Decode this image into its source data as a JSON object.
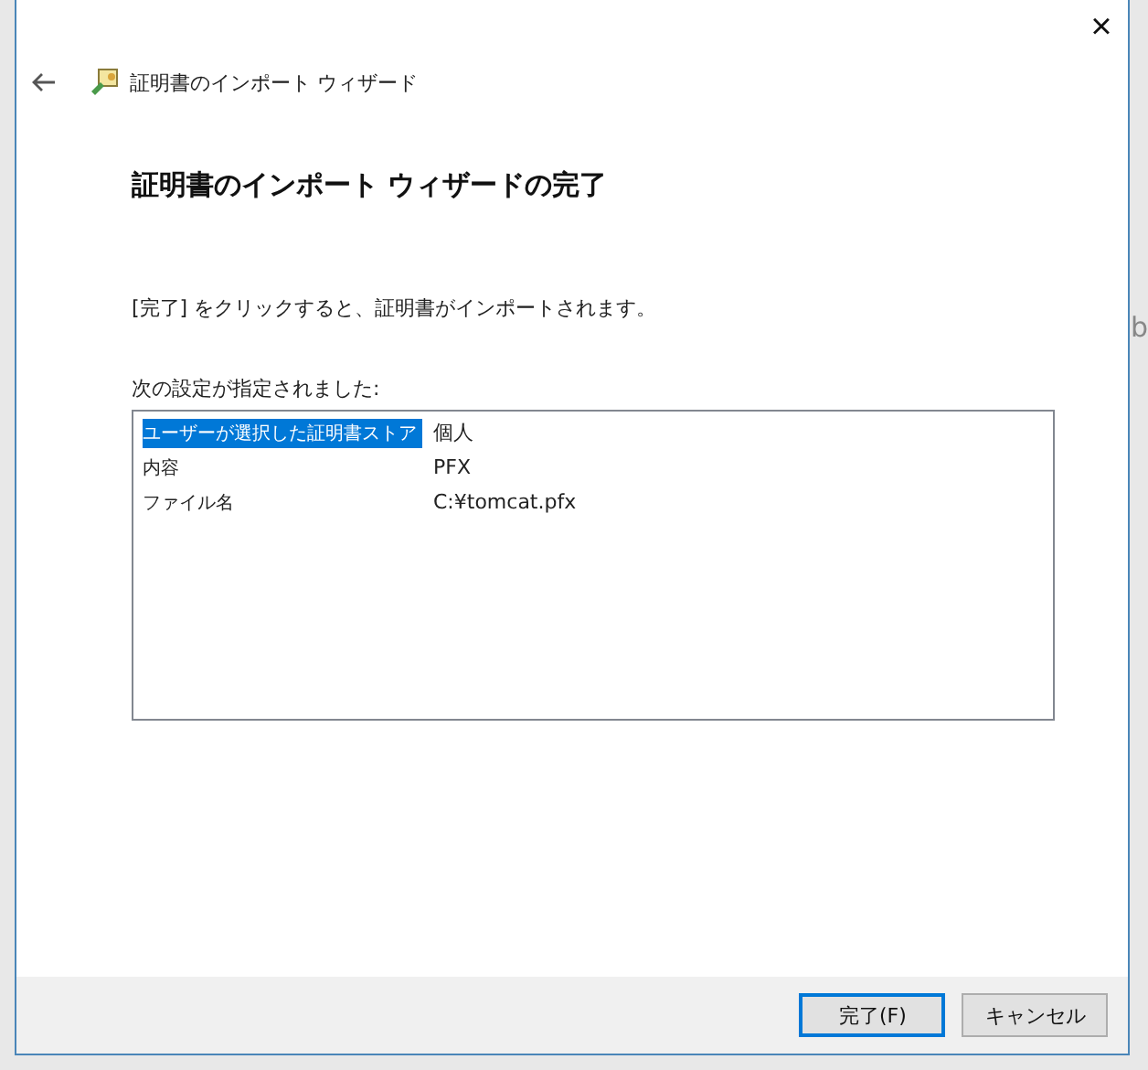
{
  "background": {
    "text": "b"
  },
  "window": {
    "title": "証明書のインポート ウィザード",
    "close": "×"
  },
  "heading": "証明書のインポート ウィザードの完了",
  "instruction": "[完了] をクリックすると、証明書がインポートされます。",
  "settings_label": "次の設定が指定されました:",
  "settings": [
    {
      "name": "ユーザーが選択した証明書ストア",
      "value": "個人",
      "selected": true
    },
    {
      "name": "内容",
      "value": "PFX",
      "selected": false
    },
    {
      "name": "ファイル名",
      "value": "C:¥tomcat.pfx",
      "selected": false
    }
  ],
  "buttons": [
    {
      "label": "完了(F)",
      "default": true
    },
    {
      "label": "キャンセル",
      "default": false
    }
  ]
}
